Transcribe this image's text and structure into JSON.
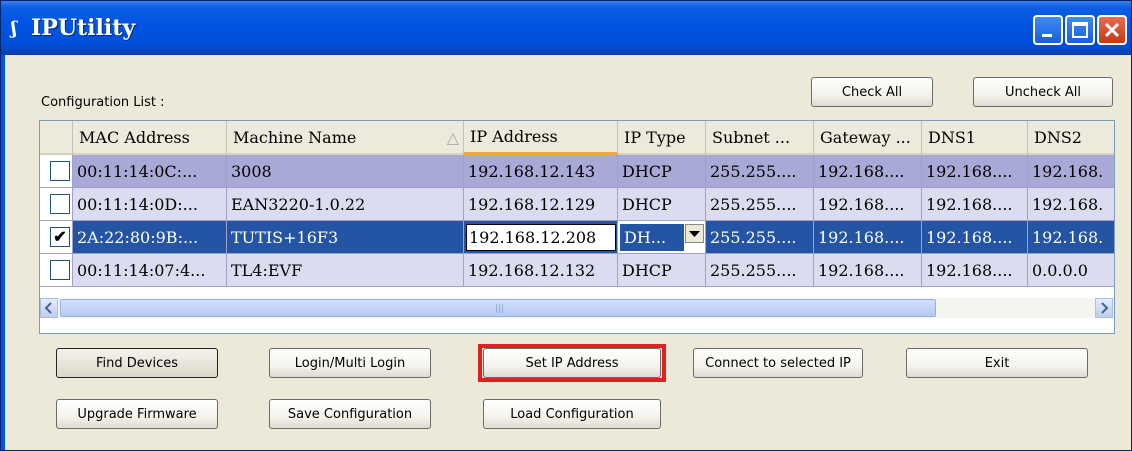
{
  "window": {
    "title": "IPUtility",
    "icon": "app-logo-icon"
  },
  "config_label": "Configuration List :",
  "buttons": {
    "check_all": "Check All",
    "uncheck_all": "Uncheck All",
    "find_devices": "Find Devices",
    "login_multi": "Login/Multi Login",
    "set_ip": "Set IP Address",
    "connect_ip": "Connect to selected IP",
    "exit": "Exit",
    "upgrade_fw": "Upgrade Firmware",
    "save_config": "Save Configuration",
    "load_config": "Load Configuration"
  },
  "table": {
    "headers": [
      "MAC Address",
      "Machine Name",
      "IP Address",
      "IP Type",
      "Subnet ...",
      "Gateway ...",
      "DNS1",
      "DNS2"
    ],
    "sort_indicator": "△",
    "rows": [
      {
        "checked": false,
        "mac": "00:11:14:0C:...",
        "name": "3008",
        "ip": "192.168.12.143",
        "type": "DHCP",
        "subnet": "255.255....",
        "gateway": "192.168....",
        "dns1": "192.168....",
        "dns2": "192.168."
      },
      {
        "checked": false,
        "mac": "00:11:14:0D:...",
        "name": "EAN3220-1.0.22",
        "ip": "192.168.12.129",
        "type": "DHCP",
        "subnet": "255.255....",
        "gateway": "192.168....",
        "dns1": "192.168....",
        "dns2": "192.168."
      },
      {
        "checked": true,
        "mac": "2A:22:80:9B:...",
        "name": "TUTIS+16F3",
        "ip": "192.168.12.208",
        "type": "DH...",
        "subnet": "255.255....",
        "gateway": "192.168....",
        "dns1": "192.168....",
        "dns2": "192.168."
      },
      {
        "checked": false,
        "mac": "00:11:14:07:4...",
        "name": "TL4:EVF",
        "ip": "192.168.12.132",
        "type": "DHCP",
        "subnet": "255.255....",
        "gateway": "192.168....",
        "dns1": "192.168....",
        "dns2": "0.0.0.0"
      }
    ]
  },
  "colors": {
    "row_alt_a": "#a9a9d8",
    "row_alt_b": "#dcdcf0",
    "row_selected": "#2454a4",
    "highlight_box": "#e02020"
  }
}
